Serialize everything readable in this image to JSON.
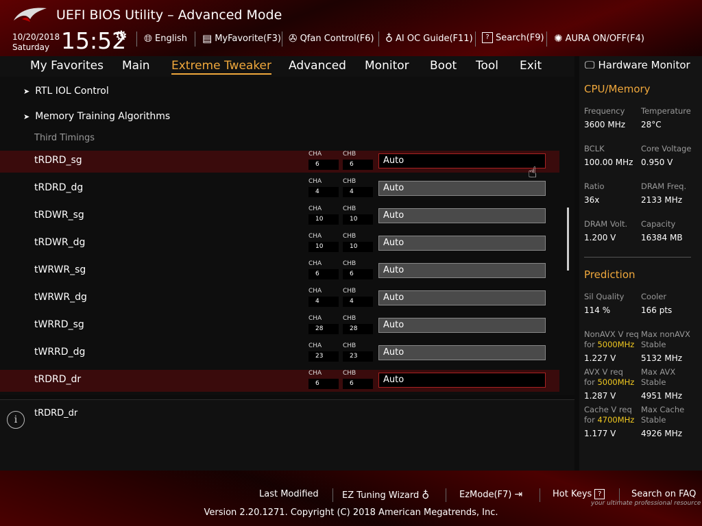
{
  "header": {
    "title": "UEFI BIOS Utility – Advanced Mode",
    "date": "10/20/2018",
    "day": "Saturday",
    "time": "15:52",
    "toolbar": [
      {
        "label": "English",
        "icon": "globe-icon"
      },
      {
        "label": "MyFavorite(F3)",
        "icon": "favorite-icon"
      },
      {
        "label": "Qfan Control(F6)",
        "icon": "fan-icon"
      },
      {
        "label": "AI OC Guide(F11)",
        "icon": "lightbulb-icon"
      },
      {
        "label": "Search(F9)",
        "icon": "search-icon"
      },
      {
        "label": "AURA ON/OFF(F4)",
        "icon": "aura-icon"
      }
    ]
  },
  "nav": {
    "tabs": [
      "My Favorites",
      "Main",
      "Extreme Tweaker",
      "Advanced",
      "Monitor",
      "Boot",
      "Tool",
      "Exit"
    ],
    "active": "Extreme Tweaker"
  },
  "main": {
    "submenus": [
      "RTL IOL Control",
      "Memory Training Algorithms"
    ],
    "section_label": "Third Timings",
    "cha_label": "CHA",
    "chb_label": "CHB",
    "rows": [
      {
        "label": "tRDRD_sg",
        "cha": "6",
        "chb": "6",
        "value": "Auto"
      },
      {
        "label": "tRDRD_dg",
        "cha": "4",
        "chb": "4",
        "value": "Auto"
      },
      {
        "label": "tRDWR_sg",
        "cha": "10",
        "chb": "10",
        "value": "Auto"
      },
      {
        "label": "tRDWR_dg",
        "cha": "10",
        "chb": "10",
        "value": "Auto"
      },
      {
        "label": "tWRWR_sg",
        "cha": "6",
        "chb": "6",
        "value": "Auto"
      },
      {
        "label": "tWRWR_dg",
        "cha": "4",
        "chb": "4",
        "value": "Auto"
      },
      {
        "label": "tWRRD_sg",
        "cha": "28",
        "chb": "28",
        "value": "Auto"
      },
      {
        "label": "tWRRD_dg",
        "cha": "23",
        "chb": "23",
        "value": "Auto"
      },
      {
        "label": "tRDRD_dr",
        "cha": "6",
        "chb": "6",
        "value": "Auto"
      }
    ]
  },
  "help": {
    "text": "tRDRD_dr"
  },
  "hardware_monitor": {
    "title": "Hardware Monitor",
    "cpu_memory": {
      "heading": "CPU/Memory",
      "items": [
        {
          "label": "Frequency",
          "value": "3600 MHz"
        },
        {
          "label": "Temperature",
          "value": "28°C"
        },
        {
          "label": "BCLK",
          "value": "100.00 MHz"
        },
        {
          "label": "Core Voltage",
          "value": "0.950 V"
        },
        {
          "label": "Ratio",
          "value": "36x"
        },
        {
          "label": "DRAM Freq.",
          "value": "2133 MHz"
        },
        {
          "label": "DRAM Volt.",
          "value": "1.200 V"
        },
        {
          "label": "Capacity",
          "value": "16384 MB"
        }
      ]
    },
    "prediction": {
      "heading": "Prediction",
      "sil_quality": {
        "label": "Sil Quality",
        "value": "114 %"
      },
      "cooler": {
        "label": "Cooler",
        "value": "166 pts"
      },
      "nonavx_req": {
        "label": "NonAVX V req",
        "for_text": "for",
        "freq": "5000MHz",
        "value": "1.227 V"
      },
      "max_nonavx": {
        "label": "Max nonAVX",
        "sub": "Stable",
        "value": "5132 MHz"
      },
      "avx_req": {
        "label": "AVX V req",
        "for_text": "for",
        "freq": "5000MHz",
        "value": "1.287 V"
      },
      "max_avx": {
        "label": "Max AVX",
        "sub": "Stable",
        "value": "4951 MHz"
      },
      "cache_req": {
        "label": "Cache V req",
        "for_text": "for",
        "freq": "4700MHz",
        "value": "1.177 V"
      },
      "max_cache": {
        "label": "Max Cache",
        "sub": "Stable",
        "value": "4926 MHz"
      }
    }
  },
  "footer": {
    "last_modified": "Last Modified",
    "ez_tuning": "EZ Tuning Wizard",
    "ezmode": "EzMode(F7)",
    "hot_keys": "Hot Keys",
    "hot_keys_key": "?",
    "search_faq": "Search on FAQ",
    "version": "Version 2.20.1271. Copyright (C) 2018 American Megatrends, Inc.",
    "watermark": "your ultimate professional resource"
  },
  "colors": {
    "accent": "#f0a83c",
    "highlight_row": "#3a0b0c",
    "header_red": "#8a0000",
    "freq_yellow": "#f0c820"
  }
}
